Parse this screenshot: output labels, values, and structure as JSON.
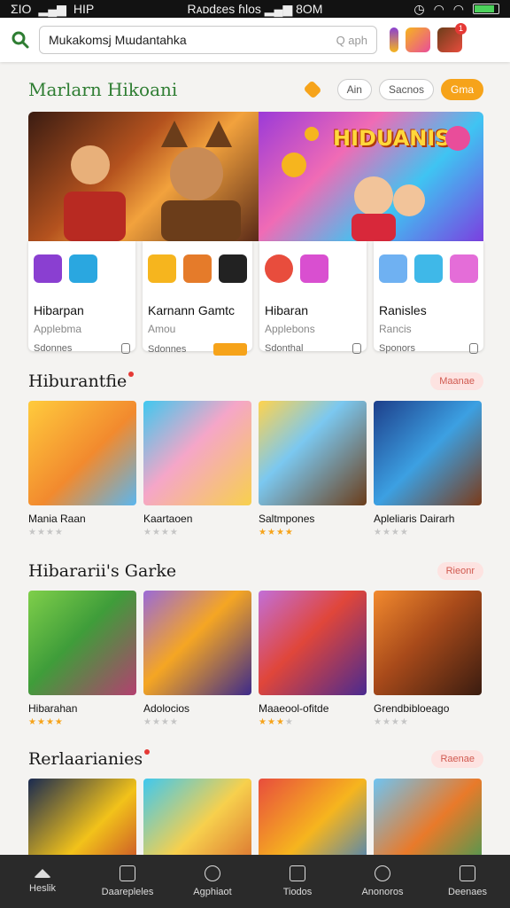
{
  "status": {
    "left_text": "ΣΙΟ",
    "signal_text": "HIP",
    "center_text": "Rᴀᴅdɛes ɦlos",
    "network": "8OM",
    "battery_level": 0.85
  },
  "search": {
    "value": "Mukakomsj Mɯdantahka",
    "placeholder": "Q aph"
  },
  "top_icons": [
    "game-controller-icon",
    "dice-app-icon",
    "game-avatar-icon"
  ],
  "notification_count": "1",
  "hero": {
    "title": "Marlarn Hikoani",
    "chips": [
      "Ain",
      "Sacnos",
      "Gma"
    ],
    "active_chip": "Gma",
    "brand_text": "HIDUANIS",
    "cards": [
      {
        "name": "Hibarpan",
        "sub": "Applebma",
        "foot": "Sdonnes",
        "thumbs": [
          "#8a3fd1",
          "#2aa7e0"
        ]
      },
      {
        "name": "Karnann Gamtc",
        "sub": "Amou",
        "foot": "Sdonnes",
        "thumbs": [
          "#f6b51e",
          "#e57b2a",
          "#222"
        ]
      },
      {
        "name": "Hibaran",
        "sub": "Applebons",
        "foot": "Sdonthal",
        "thumbs": [
          "#e84d3d",
          "#d94fd0"
        ]
      },
      {
        "name": "Ranisles",
        "sub": "Rancis",
        "foot": "Sponors",
        "thumbs": [
          "#6fb1f2",
          "#3fb8e8",
          "#e46dd8"
        ]
      }
    ]
  },
  "sections": [
    {
      "title": "Hiburantfie",
      "more": "Maanae",
      "items": [
        {
          "title": "Mania Raan",
          "stars": 0,
          "color": "linear-gradient(135deg,#ffcb3d,#f28a2e 55%,#5ab6ef)"
        },
        {
          "title": "Kaartaoen",
          "stars": 0,
          "color": "linear-gradient(135deg,#3fc8ef,#f5a6c8 45%,#f7d04d)"
        },
        {
          "title": "Saltmpones",
          "stars": 4,
          "color": "linear-gradient(135deg,#ffd34d,#7bc8f0 40%,#6b3d1a)"
        },
        {
          "title": "Apleliaris Dairarh",
          "stars": 0,
          "color": "linear-gradient(135deg,#1d3e8a,#3ca0e2 50%,#7b3b1a)"
        }
      ]
    },
    {
      "title": "Hibararii's Garke",
      "more": "Rieonr",
      "items": [
        {
          "title": "Hibarahan",
          "stars": 4,
          "color": "linear-gradient(135deg,#7fcf4a,#3f9d3a 45%,#b34070)"
        },
        {
          "title": "Adolocios",
          "stars": 0,
          "color": "linear-gradient(135deg,#9a6ad8,#f5a623 45%,#3d2a8a)"
        },
        {
          "title": "Maaeool-ofitde",
          "stars": 3,
          "color": "linear-gradient(135deg,#c26fd8,#e0463a 45%,#4a2a90)"
        },
        {
          "title": "Grendbibloeago",
          "stars": 0,
          "color": "linear-gradient(135deg,#f28a2e,#a84a1a 45%,#3a1c10)"
        }
      ]
    },
    {
      "title": "Rerlaarianies",
      "more": "Raenae",
      "items": [
        {
          "title": "",
          "stars": 0,
          "color": "linear-gradient(135deg,#1a2a50,#f2c21a 55%,#c0392b)"
        },
        {
          "title": "",
          "stars": 0,
          "color": "linear-gradient(135deg,#3fc8ef,#f7d04d 50%,#d5602a)"
        },
        {
          "title": "",
          "stars": 0,
          "color": "linear-gradient(135deg,#e84d3d,#f6b51e 50%,#2a7ad5)"
        },
        {
          "title": "",
          "stars": 0,
          "color": "linear-gradient(135deg,#6fc4f2,#e97a2a 50%,#2aa05a)"
        }
      ]
    }
  ],
  "bottom_nav": [
    {
      "label": "Heslik",
      "icon": "home-icon"
    },
    {
      "label": "Daarepleles",
      "icon": "grid-icon"
    },
    {
      "label": "Agphiaot",
      "icon": "compass-icon"
    },
    {
      "label": "Tiodos",
      "icon": "download-icon"
    },
    {
      "label": "Anonoros",
      "icon": "gauge-icon"
    },
    {
      "label": "Deenaes",
      "icon": "chart-icon"
    }
  ],
  "colors": {
    "accent": "#f6a31a",
    "brand_green": "#2e7d32",
    "nav_bg": "#2a2a2a"
  }
}
